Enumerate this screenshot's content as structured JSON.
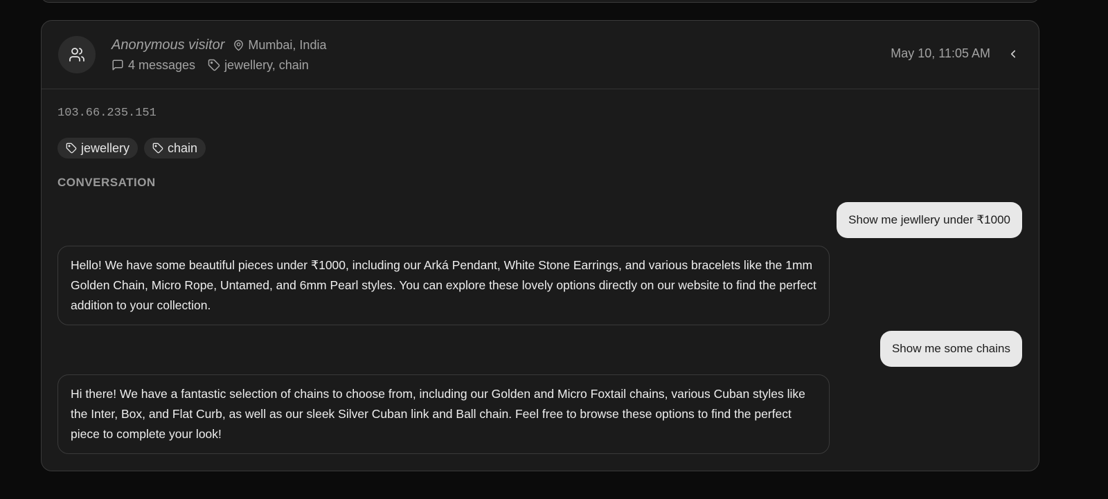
{
  "visitor": {
    "name": "Anonymous visitor",
    "location": "Mumbai, India",
    "message_count": "4 messages",
    "tags_summary": "jewellery, chain",
    "timestamp": "May 10, 11:05 AM",
    "ip": "103.66.235.151",
    "tags": [
      "jewellery",
      "chain"
    ]
  },
  "conversation": {
    "section_title": "CONVERSATION",
    "messages": [
      {
        "role": "user",
        "text": "Show me jewllery under ₹1000"
      },
      {
        "role": "assistant",
        "text": "Hello! We have some beautiful pieces under ₹1000, including our Arká Pendant, White Stone Earrings, and various bracelets like the 1mm Golden Chain, Micro Rope, Untamed, and 6mm Pearl styles. You can explore these lovely options directly on our website to find the perfect addition to your collection."
      },
      {
        "role": "user",
        "text": "Show me some chains"
      },
      {
        "role": "assistant",
        "text": "Hi there! We have a fantastic selection of chains to choose from, including our Golden and Micro Foxtail chains, various Cuban styles like the Inter, Box, and Flat Curb, as well as our sleek Silver Cuban link and Ball chain. Feel free to browse these options to find the perfect piece to complete your look!"
      }
    ]
  },
  "icons": {
    "avatar": "users-icon",
    "location": "map-pin-icon",
    "messages": "message-square-icon",
    "tags": "tag-icon",
    "collapse": "chevron-left-icon"
  },
  "colors": {
    "background": "#0b0b0b",
    "card": "#1b1b1b",
    "border": "#3a3a3a",
    "muted_text": "#a3a3a3",
    "user_bubble": "#e8e8e8"
  }
}
